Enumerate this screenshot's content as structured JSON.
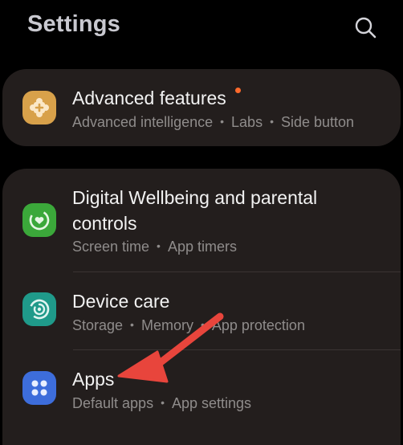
{
  "header": {
    "title": "Settings",
    "search_icon": "search-icon"
  },
  "items": [
    {
      "title": "Advanced features",
      "subs": [
        "Advanced intelligence",
        "Labs",
        "Side button"
      ],
      "icon": "puzzle-plus-icon",
      "icon_color": "#d8a14a",
      "has_badge": true
    },
    {
      "title": "Digital Wellbeing and parental controls",
      "title_line1": "Digital Wellbeing and parental",
      "title_line2": "controls",
      "subs": [
        "Screen time",
        "App timers"
      ],
      "icon": "wellbeing-icon",
      "icon_color": "#3ba83a"
    },
    {
      "title": "Device care",
      "subs": [
        "Storage",
        "Memory",
        "App protection"
      ],
      "icon": "device-care-icon",
      "icon_color": "#1f9a8a"
    },
    {
      "title": "Apps",
      "subs": [
        "Default apps",
        "App settings"
      ],
      "icon": "apps-grid-icon",
      "icon_color": "#3d6ddb"
    }
  ],
  "annotation": {
    "type": "arrow",
    "color": "#e8453c",
    "points_to": "Apps"
  }
}
